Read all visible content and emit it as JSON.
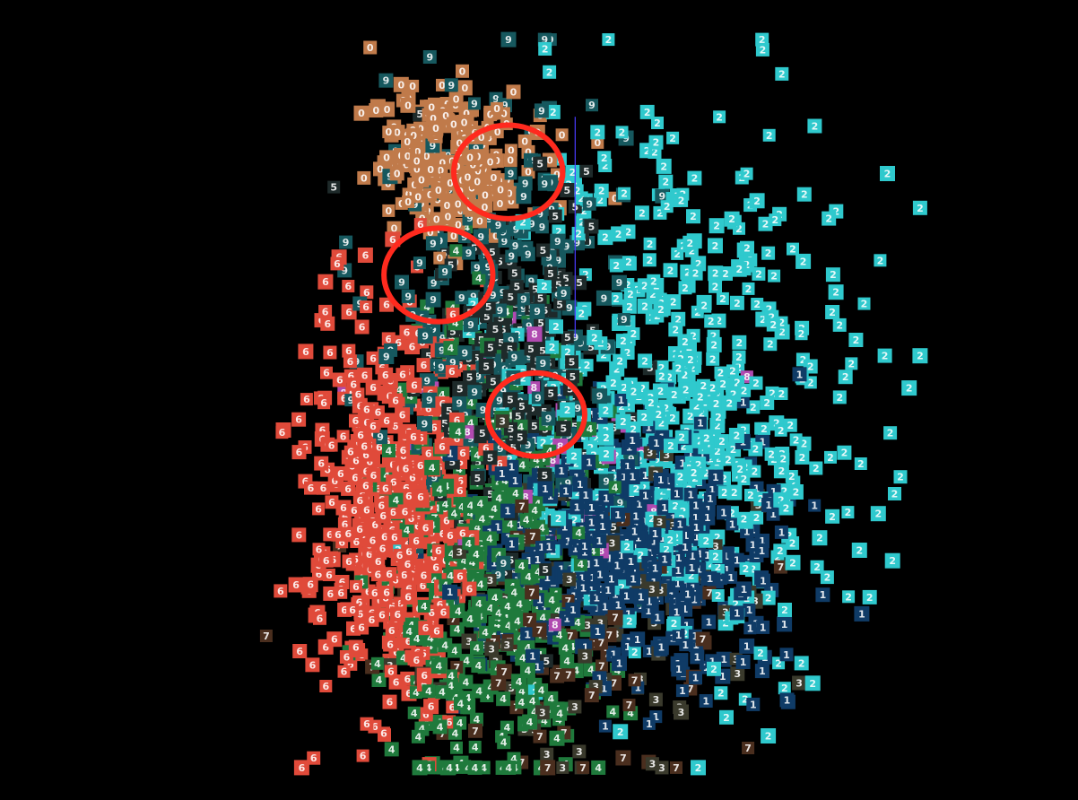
{
  "chart_data": {
    "type": "scatter",
    "description_level": "embedding projection of handwritten digit thumbnails",
    "background": "#000000",
    "grid": false,
    "legend": "none",
    "xlim": [
      0,
      1
    ],
    "ylim": [
      0,
      1
    ],
    "series": [
      {
        "digit": "0",
        "color": "#c07a4a",
        "count": 260,
        "cluster": {
          "cx": 0.355,
          "cy": 0.83,
          "sx": 0.055,
          "sy": 0.05
        }
      },
      {
        "digit": "1",
        "color": "#0f3b66",
        "count": 520,
        "cluster": {
          "cx": 0.6,
          "cy": 0.3,
          "sx": 0.1,
          "sy": 0.09
        }
      },
      {
        "digit": "2",
        "color": "#2fc9cd",
        "count": 560,
        "cluster": {
          "cx": 0.68,
          "cy": 0.5,
          "sx": 0.12,
          "sy": 0.18
        }
      },
      {
        "digit": "3",
        "color": "#3a3a2c",
        "count": 90,
        "cluster": {
          "cx": 0.55,
          "cy": 0.22,
          "sx": 0.12,
          "sy": 0.12
        }
      },
      {
        "digit": "4",
        "color": "#1f7a3c",
        "count": 420,
        "cluster": {
          "cx": 0.41,
          "cy": 0.28,
          "sx": 0.07,
          "sy": 0.16
        }
      },
      {
        "digit": "5",
        "color": "#1e2a2a",
        "count": 200,
        "cluster": {
          "cx": 0.45,
          "cy": 0.55,
          "sx": 0.07,
          "sy": 0.12
        }
      },
      {
        "digit": "6",
        "color": "#e04a3a",
        "count": 520,
        "cluster": {
          "cx": 0.275,
          "cy": 0.35,
          "sx": 0.06,
          "sy": 0.13
        }
      },
      {
        "digit": "7",
        "color": "#4a2e1e",
        "count": 70,
        "cluster": {
          "cx": 0.53,
          "cy": 0.18,
          "sx": 0.12,
          "sy": 0.1
        }
      },
      {
        "digit": "8",
        "color": "#b04ab0",
        "count": 30,
        "cluster": {
          "cx": 0.46,
          "cy": 0.4,
          "sx": 0.1,
          "sy": 0.15
        }
      },
      {
        "digit": "9",
        "color": "#16585e",
        "count": 260,
        "cluster": {
          "cx": 0.43,
          "cy": 0.62,
          "sx": 0.08,
          "sy": 0.16
        }
      }
    ],
    "annotations": [
      {
        "type": "circle",
        "color": "#ff2a1e",
        "cx": 0.435,
        "cy": 0.815,
        "r": 0.074
      },
      {
        "type": "circle",
        "color": "#ff2a1e",
        "cx": 0.34,
        "cy": 0.675,
        "r": 0.074
      },
      {
        "type": "circle",
        "color": "#ff2a1e",
        "cx": 0.473,
        "cy": 0.485,
        "r": 0.066
      }
    ],
    "axis_line": {
      "color": "#4a3cff",
      "x": 0.526,
      "y0": 0.59,
      "y1": 0.89
    }
  }
}
